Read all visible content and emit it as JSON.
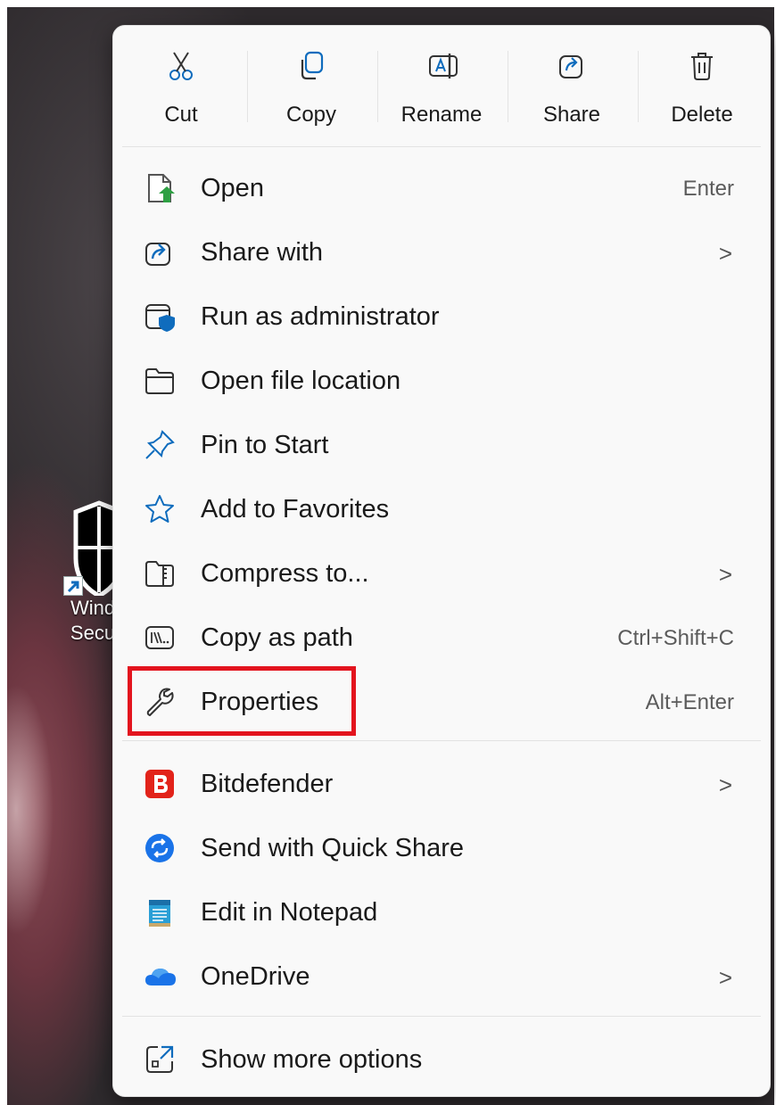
{
  "desktop": {
    "icon_label_line1": "Wind",
    "icon_label_line2": "Secu"
  },
  "toolbar": {
    "cut_label": "Cut",
    "copy_label": "Copy",
    "rename_label": "Rename",
    "share_label": "Share",
    "delete_label": "Delete"
  },
  "menu": {
    "items": [
      {
        "label": "Open",
        "shortcut": "Enter",
        "icon": "open-file-icon"
      },
      {
        "label": "Share with",
        "submenu": true,
        "icon": "share-icon"
      },
      {
        "label": "Run as administrator",
        "icon": "admin-shield-icon"
      },
      {
        "label": "Open file location",
        "icon": "folder-icon"
      },
      {
        "label": "Pin to Start",
        "icon": "pin-icon"
      },
      {
        "label": "Add to Favorites",
        "icon": "star-icon"
      },
      {
        "label": "Compress to...",
        "submenu": true,
        "icon": "zip-folder-icon"
      },
      {
        "label": "Copy as path",
        "shortcut": "Ctrl+Shift+C",
        "icon": "path-icon"
      },
      {
        "label": "Properties",
        "shortcut": "Alt+Enter",
        "icon": "wrench-icon",
        "highlighted": true
      },
      {
        "label": "Bitdefender",
        "submenu": true,
        "icon": "bitdefender-icon"
      },
      {
        "label": "Send with Quick Share",
        "icon": "quick-share-icon"
      },
      {
        "label": "Edit in Notepad",
        "icon": "notepad-icon"
      },
      {
        "label": "OneDrive",
        "submenu": true,
        "icon": "onedrive-icon"
      },
      {
        "label": "Show more options",
        "icon": "more-options-icon"
      }
    ],
    "chevron": ">"
  },
  "colors": {
    "accent": "#0f6cbd",
    "highlight_box": "#e3141e",
    "bitdefender": "#e2231a",
    "onedrive": "#1a73e8"
  }
}
